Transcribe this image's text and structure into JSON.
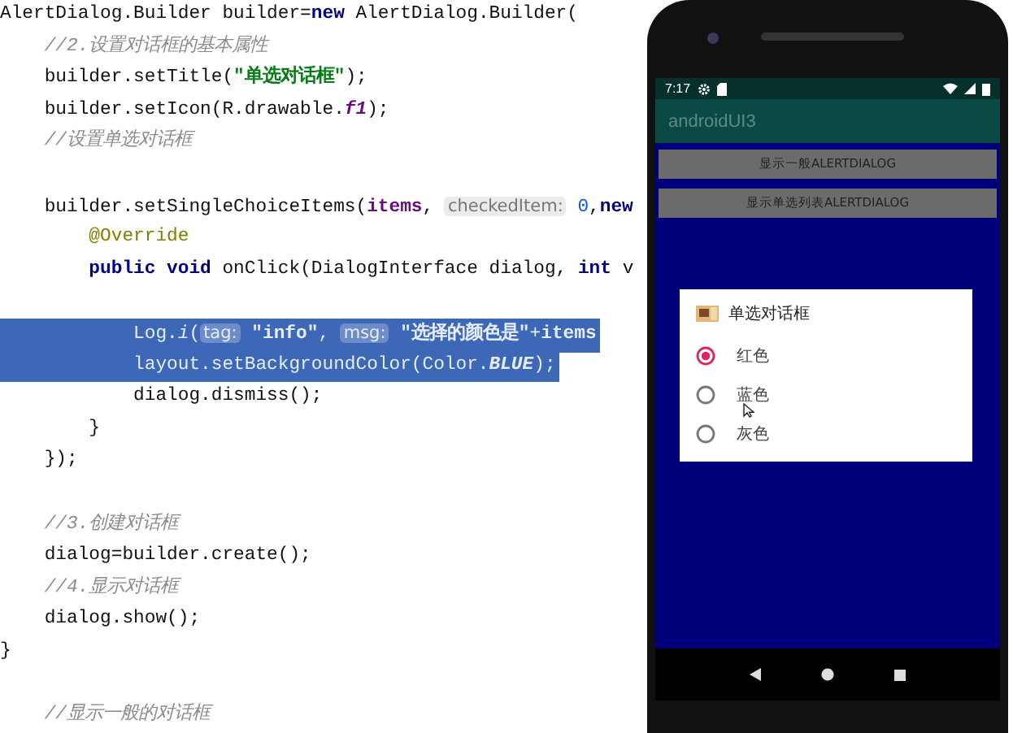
{
  "editor": {
    "lines": [
      {
        "tokens": [
          {
            "kind": "plain",
            "text": "AlertDialog.Builder builder="
          },
          {
            "kind": "keyword",
            "text": "new"
          },
          {
            "kind": "plain",
            "text": " AlertDialog.Builder("
          }
        ]
      },
      {
        "tokens": [
          {
            "kind": "comment",
            "text": "    //2.设置对话框的基本属性"
          }
        ]
      },
      {
        "tokens": [
          {
            "kind": "plain",
            "text": "    builder.setTitle("
          },
          {
            "kind": "string",
            "text": "\"单选对话框\""
          },
          {
            "kind": "plain",
            "text": ");"
          }
        ]
      },
      {
        "tokens": [
          {
            "kind": "plain",
            "text": "    builder.setIcon(R.drawable."
          },
          {
            "kind": "constant",
            "text": "f1"
          },
          {
            "kind": "plain",
            "text": ");"
          }
        ]
      },
      {
        "tokens": [
          {
            "kind": "comment",
            "text": "    //设置单选对话框"
          }
        ]
      },
      {
        "space_before": true,
        "tokens": [
          {
            "kind": "plain",
            "text": "    builder.setSingleChoiceItems("
          },
          {
            "kind": "field",
            "text": "items"
          },
          {
            "kind": "plain",
            "text": ", "
          },
          {
            "kind": "hint",
            "text": "checkedItem:"
          },
          {
            "kind": "number",
            "text": " 0"
          },
          {
            "kind": "plain",
            "text": ","
          },
          {
            "kind": "keyword",
            "text": "new"
          }
        ]
      },
      {
        "tokens": [
          {
            "kind": "annotation",
            "text": "        @Override"
          }
        ]
      },
      {
        "tokens": [
          {
            "kind": "keyword",
            "text": "        public void "
          },
          {
            "kind": "plain",
            "text": "onClick(DialogInterface dialog, "
          },
          {
            "kind": "keyword",
            "text": "int "
          },
          {
            "kind": "plain",
            "text": "v"
          }
        ]
      },
      {
        "space_before": true,
        "highlighted": true,
        "tokens": [
          {
            "kind": "plain",
            "text": "            Log."
          },
          {
            "kind": "italic",
            "text": "i"
          },
          {
            "kind": "plain",
            "text": "("
          },
          {
            "kind": "hint",
            "text": "tag:"
          },
          {
            "kind": "string",
            "text": " \"info\""
          },
          {
            "kind": "plain",
            "text": ", "
          },
          {
            "kind": "hint",
            "text": "msg:"
          },
          {
            "kind": "string",
            "text": " \"选择的颜色是\""
          },
          {
            "kind": "plain",
            "text": "+"
          },
          {
            "kind": "field",
            "text": "items"
          }
        ]
      },
      {
        "highlighted": true,
        "tokens": [
          {
            "kind": "plain",
            "text": "            layout.setBackgroundColor(Color."
          },
          {
            "kind": "constant",
            "text": "BLUE"
          },
          {
            "kind": "plain",
            "text": ");"
          }
        ]
      },
      {
        "tokens": [
          {
            "kind": "plain",
            "text": "            dialog.dismiss();"
          }
        ]
      },
      {
        "tokens": [
          {
            "kind": "plain",
            "text": "        }"
          }
        ]
      },
      {
        "tokens": [
          {
            "kind": "plain",
            "text": "    });"
          }
        ]
      },
      {
        "space_before": true,
        "tokens": [
          {
            "kind": "comment",
            "text": "    //3.创建对话框"
          }
        ]
      },
      {
        "tokens": [
          {
            "kind": "plain",
            "text": "    dialog=builder.create();"
          }
        ]
      },
      {
        "tokens": [
          {
            "kind": "comment",
            "text": "    //4.显示对话框"
          }
        ]
      },
      {
        "tokens": [
          {
            "kind": "plain",
            "text": "    dialog.show();"
          }
        ]
      },
      {
        "tokens": [
          {
            "kind": "plain",
            "text": "}"
          }
        ]
      },
      {
        "space_before": true,
        "tokens": [
          {
            "kind": "comment",
            "text": "    //显示一般的对话框"
          }
        ]
      }
    ]
  },
  "phone": {
    "status_bar": {
      "time": "7:17"
    },
    "app_title": "androidUI3",
    "buttons": [
      "显示一般ALERTDIALOG",
      "显示单选列表ALERTDIALOG"
    ],
    "dialog": {
      "title": "单选对话框",
      "options": [
        {
          "label": "红色",
          "selected": true
        },
        {
          "label": "蓝色",
          "selected": false
        },
        {
          "label": "灰色",
          "selected": false
        }
      ]
    }
  }
}
